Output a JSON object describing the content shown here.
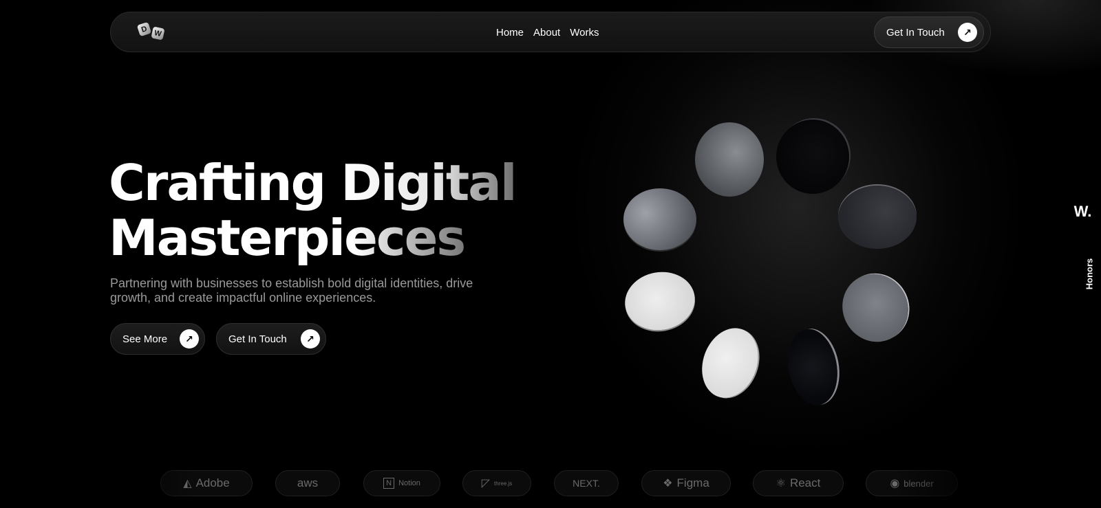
{
  "nav": {
    "logo_letters": [
      "D",
      "W"
    ],
    "links": [
      "Home",
      "About",
      "Works"
    ],
    "cta_label": "Get In Touch"
  },
  "hero": {
    "headline_line1_a": "Crafting ",
    "headline_line1_b": "Digital",
    "headline_line2": "Masterpieces",
    "subtitle": "Partnering with businesses to establish bold digital identities, drive growth, and create impactful online experiences.",
    "buttons": {
      "see_more": "See More",
      "get_in_touch": "Get In Touch"
    }
  },
  "side_tab": {
    "logo": "W.",
    "label": "Honors"
  },
  "brands": [
    {
      "name": "Adobe",
      "icon": "adobe-icon"
    },
    {
      "name": "aws",
      "icon": "aws-icon"
    },
    {
      "name": "Notion",
      "icon": "notion-icon"
    },
    {
      "name": "three.js",
      "icon": "threejs-icon"
    },
    {
      "name": "NEXT.",
      "icon": "next-icon"
    },
    {
      "name": "Figma",
      "icon": "figma-icon"
    },
    {
      "name": "React",
      "icon": "react-icon"
    },
    {
      "name": "blender",
      "icon": "blender-icon"
    }
  ],
  "colors": {
    "background": "#000000",
    "text": "#ffffff",
    "muted_text": "#9a9a9a"
  }
}
